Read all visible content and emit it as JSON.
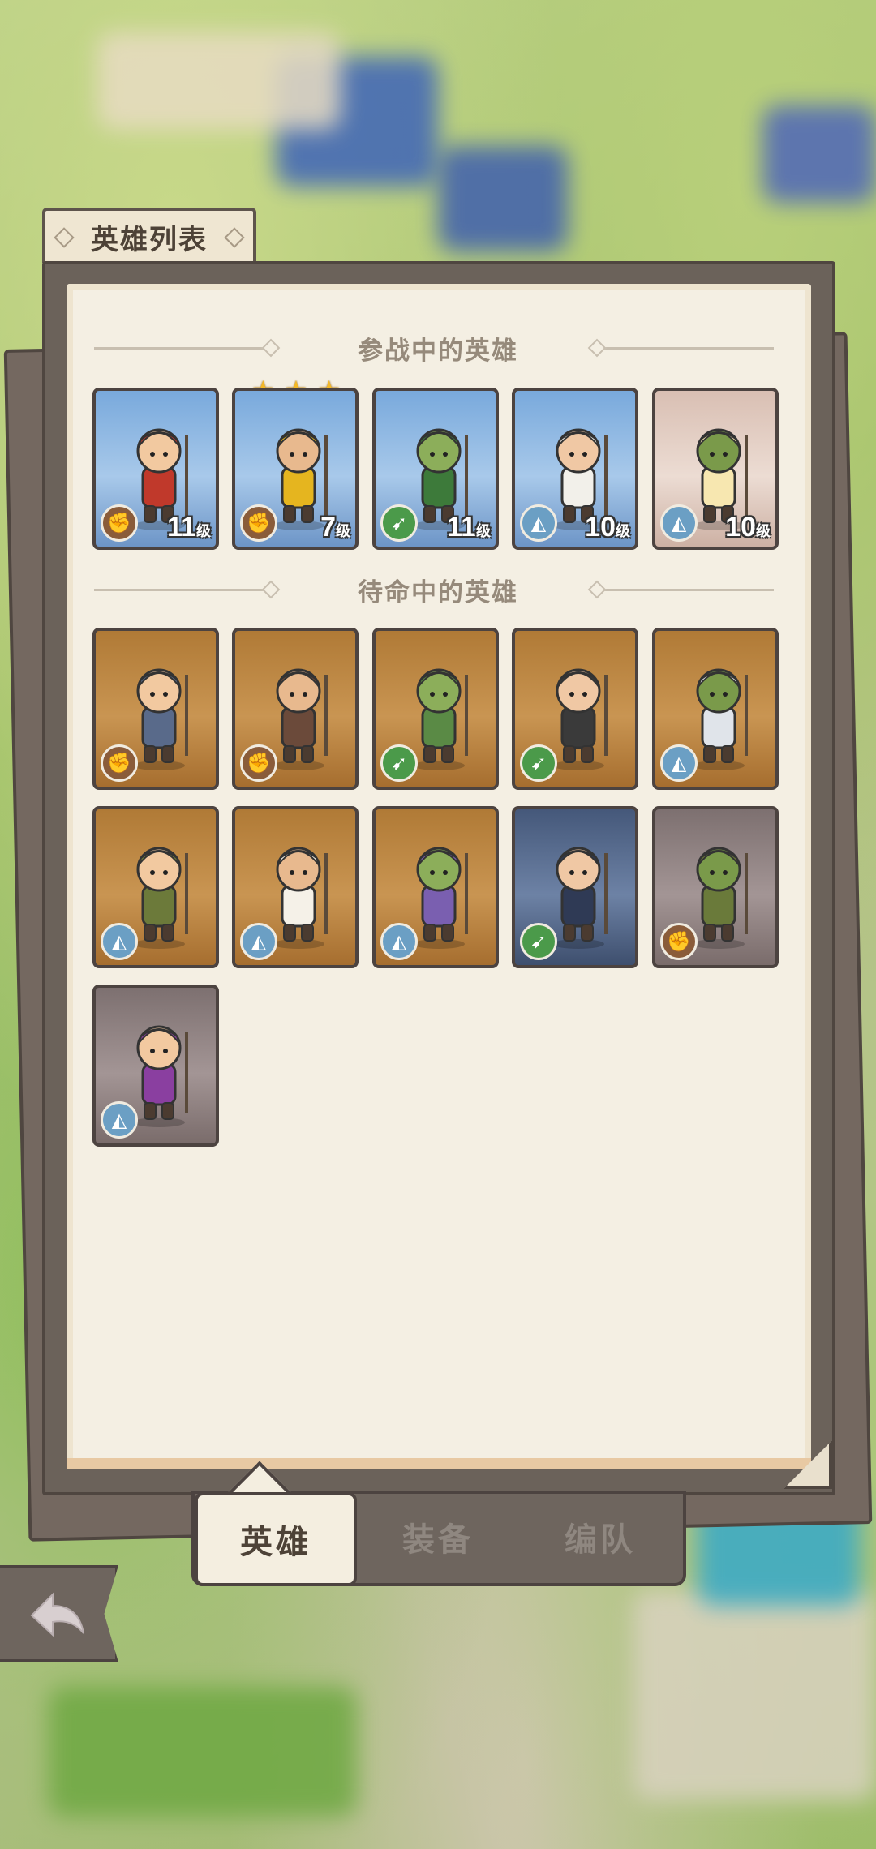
{
  "header": {
    "title": "英雄列表"
  },
  "sections": {
    "active": "参战中的英雄",
    "standby": "待命中的英雄"
  },
  "active_heroes": [
    {
      "name": "hero-knight",
      "bg": "blue",
      "class": "fist",
      "level": "11",
      "level_unit": "级"
    },
    {
      "name": "hero-gold-paladin",
      "bg": "blue",
      "class": "fist",
      "level": "7",
      "level_unit": "级",
      "stars": 3
    },
    {
      "name": "hero-dwarf-ranger",
      "bg": "blue",
      "class": "bow",
      "level": "11",
      "level_unit": "级"
    },
    {
      "name": "hero-fire-mage",
      "bg": "blue",
      "class": "mage",
      "level": "10",
      "level_unit": "级"
    },
    {
      "name": "hero-priestess",
      "bg": "pink",
      "class": "mage",
      "level": "10",
      "level_unit": "级"
    }
  ],
  "standby_heroes": [
    {
      "name": "hero-sword-knight",
      "bg": "brown",
      "class": "fist"
    },
    {
      "name": "hero-minotaur",
      "bg": "brown",
      "class": "fist"
    },
    {
      "name": "hero-elf-archer",
      "bg": "brown",
      "class": "bow"
    },
    {
      "name": "hero-barbarian",
      "bg": "brown",
      "class": "bow"
    },
    {
      "name": "hero-hammer-elder",
      "bg": "brown",
      "class": "mage"
    },
    {
      "name": "hero-orc-shaman",
      "bg": "brown",
      "class": "mage"
    },
    {
      "name": "hero-cleric",
      "bg": "brown",
      "class": "mage"
    },
    {
      "name": "hero-gnome",
      "bg": "brown",
      "class": "mage"
    },
    {
      "name": "hero-dark-elf",
      "bg": "slate",
      "class": "bow"
    },
    {
      "name": "hero-orc-axe",
      "bg": "gray",
      "class": "fist"
    },
    {
      "name": "hero-sorceress",
      "bg": "gray",
      "class": "mage"
    }
  ],
  "nav": {
    "tab_heroes": "英雄",
    "tab_equipment": "装备",
    "tab_formation": "编队"
  },
  "icons": {
    "back": "back-arrow-icon",
    "star": "star-icon",
    "fist": "fist-icon",
    "bow": "bow-icon",
    "mage": "mage-hat-icon"
  },
  "colors": {
    "panel": "#6b625a",
    "paper": "#f4efe3",
    "star": "#f4b927"
  }
}
